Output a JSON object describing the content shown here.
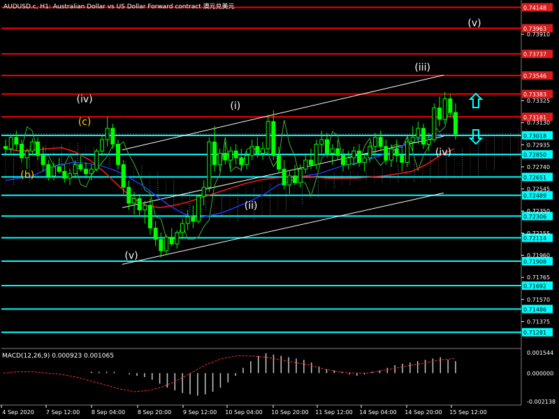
{
  "title_bar": "AUDUSD.c, H1:  Australian Dollar vs US Dollar Forward contract  澳元兑美元",
  "colors": {
    "background": "#000000",
    "candle": "#00ff00",
    "red_line": "#ff0000",
    "cyan_line": "#00ffff",
    "channel": "#ffffff",
    "ma_blue": "#1e3cff",
    "ma_red": "#ff1a1a",
    "oscillator": "#3cb43c",
    "label_box": "#d81e1e"
  },
  "chart_data": [
    {
      "type": "candlestick",
      "symbol": "AUDUSD.c",
      "timeframe": "H1",
      "ylim": [
        0.7115,
        0.742
      ],
      "xlabels": [
        "4 Sep 2020",
        "7 Sep 12:00",
        "8 Sep 04:00",
        "8 Sep 20:00",
        "9 Sep 12:00",
        "10 Sep 04:00",
        "10 Sep 20:00",
        "11 Sep 12:00",
        "14 Sep 04:00",
        "14 Sep 20:00",
        "15 Sep 12:00"
      ],
      "price_ticks": [
        "0.73910",
        "0.73325",
        "0.73130",
        "0.72935",
        "0.72740",
        "0.72545",
        "0.72350",
        "0.72155",
        "0.71960",
        "0.71765",
        "0.71570",
        "0.71375"
      ],
      "resistance_levels": [
        "0.74148",
        "0.73963",
        "0.73737",
        "0.73546",
        "0.73383",
        "0.73181"
      ],
      "support_levels": [
        "0.73018",
        "0.72850",
        "0.72651",
        "0.72489",
        "0.72306",
        "0.72114",
        "0.71908",
        "0.71692",
        "0.71486",
        "0.71281"
      ],
      "current_price": 0.7303,
      "wave_labels": [
        {
          "text": "(iv)",
          "color": "#ffffff",
          "x": 0.16,
          "price": 0.7331
        },
        {
          "text": "(c)",
          "color": "#ffd700",
          "x": 0.16,
          "price": 0.7311
        },
        {
          "text": "(b)",
          "color": "#ffd700",
          "x": 0.05,
          "price": 0.7264
        },
        {
          "text": "(v)",
          "color": "#ffffff",
          "x": 0.25,
          "price": 0.7193
        },
        {
          "text": "(i)",
          "color": "#ffffff",
          "x": 0.45,
          "price": 0.7325
        },
        {
          "text": "(ii)",
          "color": "#ffffff",
          "x": 0.48,
          "price": 0.7237
        },
        {
          "text": "(iii)",
          "color": "#ffffff",
          "x": 0.81,
          "price": 0.7359
        },
        {
          "text": "(iv)",
          "color": "#ffffff",
          "x": 0.85,
          "price": 0.7284
        },
        {
          "text": "(v)",
          "color": "#ffffff",
          "x": 0.91,
          "price": 0.7398
        }
      ],
      "candles": [
        [
          0.7292,
          0.7298,
          0.7284,
          0.729
        ],
        [
          0.729,
          0.7302,
          0.7286,
          0.73
        ],
        [
          0.73,
          0.7306,
          0.7288,
          0.7294
        ],
        [
          0.7294,
          0.7298,
          0.7278,
          0.7282
        ],
        [
          0.7282,
          0.729,
          0.7272,
          0.7288
        ],
        [
          0.7288,
          0.7299,
          0.7284,
          0.7296
        ],
        [
          0.7296,
          0.73,
          0.728,
          0.7284
        ],
        [
          0.7284,
          0.7292,
          0.727,
          0.7276
        ],
        [
          0.7276,
          0.728,
          0.7262,
          0.7266
        ],
        [
          0.7266,
          0.7278,
          0.7262,
          0.7274
        ],
        [
          0.7274,
          0.7282,
          0.7268,
          0.727
        ],
        [
          0.727,
          0.7276,
          0.726,
          0.7264
        ],
        [
          0.7264,
          0.7272,
          0.7258,
          0.7268
        ],
        [
          0.7268,
          0.728,
          0.7264,
          0.7276
        ],
        [
          0.7276,
          0.7284,
          0.727,
          0.7272
        ],
        [
          0.7272,
          0.7278,
          0.7264,
          0.7268
        ],
        [
          0.7268,
          0.7276,
          0.7262,
          0.7272
        ],
        [
          0.7272,
          0.729,
          0.727,
          0.7288
        ],
        [
          0.7288,
          0.7302,
          0.7284,
          0.7298
        ],
        [
          0.7298,
          0.7318,
          0.7292,
          0.7308
        ],
        [
          0.7308,
          0.7312,
          0.729,
          0.7294
        ],
        [
          0.7294,
          0.7298,
          0.7272,
          0.7276
        ],
        [
          0.7276,
          0.728,
          0.725,
          0.7256
        ],
        [
          0.7256,
          0.7262,
          0.7236,
          0.7242
        ],
        [
          0.7242,
          0.7252,
          0.7232,
          0.7246
        ],
        [
          0.7246,
          0.725,
          0.723,
          0.7236
        ],
        [
          0.7236,
          0.7244,
          0.7224,
          0.724
        ],
        [
          0.724,
          0.7246,
          0.7214,
          0.722
        ],
        [
          0.722,
          0.7226,
          0.7204,
          0.721
        ],
        [
          0.721,
          0.7216,
          0.7194,
          0.72
        ],
        [
          0.72,
          0.7214,
          0.7196,
          0.7212
        ],
        [
          0.7212,
          0.722,
          0.7204,
          0.7206
        ],
        [
          0.7206,
          0.7218,
          0.7202,
          0.7216
        ],
        [
          0.7216,
          0.7228,
          0.721,
          0.7224
        ],
        [
          0.7224,
          0.7236,
          0.7218,
          0.723
        ],
        [
          0.723,
          0.724,
          0.722,
          0.7226
        ],
        [
          0.7226,
          0.725,
          0.7224,
          0.7248
        ],
        [
          0.7248,
          0.7262,
          0.724,
          0.7256
        ],
        [
          0.7256,
          0.73,
          0.7252,
          0.7296
        ],
        [
          0.7296,
          0.731,
          0.727,
          0.7276
        ],
        [
          0.7276,
          0.729,
          0.727,
          0.7286
        ],
        [
          0.7286,
          0.7296,
          0.7276,
          0.728
        ],
        [
          0.728,
          0.7292,
          0.7272,
          0.7288
        ],
        [
          0.7288,
          0.7294,
          0.7276,
          0.7282
        ],
        [
          0.7282,
          0.729,
          0.727,
          0.7276
        ],
        [
          0.7276,
          0.7288,
          0.7272,
          0.7284
        ],
        [
          0.7284,
          0.7298,
          0.728,
          0.7292
        ],
        [
          0.7292,
          0.73,
          0.7282,
          0.7286
        ],
        [
          0.7286,
          0.7296,
          0.728,
          0.729
        ],
        [
          0.729,
          0.732,
          0.7286,
          0.7314
        ],
        [
          0.7314,
          0.7324,
          0.728,
          0.7284
        ],
        [
          0.7284,
          0.7292,
          0.7268,
          0.7272
        ],
        [
          0.7272,
          0.728,
          0.7254,
          0.7258
        ],
        [
          0.7258,
          0.727,
          0.725,
          0.7266
        ],
        [
          0.7266,
          0.7276,
          0.7258,
          0.726
        ],
        [
          0.726,
          0.7276,
          0.7256,
          0.7272
        ],
        [
          0.7272,
          0.7286,
          0.7268,
          0.728
        ],
        [
          0.728,
          0.729,
          0.7272,
          0.7276
        ],
        [
          0.7276,
          0.7298,
          0.7272,
          0.7294
        ],
        [
          0.7294,
          0.7306,
          0.7286,
          0.7298
        ],
        [
          0.7298,
          0.7304,
          0.7282,
          0.7286
        ],
        [
          0.7286,
          0.7294,
          0.7276,
          0.729
        ],
        [
          0.729,
          0.7298,
          0.728,
          0.7284
        ],
        [
          0.7284,
          0.729,
          0.727,
          0.7276
        ],
        [
          0.7276,
          0.7288,
          0.7272,
          0.7282
        ],
        [
          0.7282,
          0.7292,
          0.7276,
          0.7288
        ],
        [
          0.7288,
          0.7294,
          0.7274,
          0.7278
        ],
        [
          0.7278,
          0.7286,
          0.727,
          0.7282
        ],
        [
          0.7282,
          0.7296,
          0.7278,
          0.7292
        ],
        [
          0.7292,
          0.7304,
          0.7286,
          0.73
        ],
        [
          0.73,
          0.7306,
          0.7288,
          0.7292
        ],
        [
          0.7292,
          0.7298,
          0.7276,
          0.728
        ],
        [
          0.728,
          0.7294,
          0.7274,
          0.729
        ],
        [
          0.729,
          0.7298,
          0.7278,
          0.7284
        ],
        [
          0.7284,
          0.729,
          0.727,
          0.7278
        ],
        [
          0.7278,
          0.73,
          0.7274,
          0.7296
        ],
        [
          0.7296,
          0.731,
          0.7288,
          0.73
        ],
        [
          0.73,
          0.7314,
          0.7294,
          0.7308
        ],
        [
          0.7308,
          0.7312,
          0.729,
          0.7294
        ],
        [
          0.7294,
          0.7304,
          0.7288,
          0.7298
        ],
        [
          0.7298,
          0.733,
          0.7296,
          0.7326
        ],
        [
          0.7326,
          0.7336,
          0.731,
          0.7316
        ],
        [
          0.7316,
          0.734,
          0.7312,
          0.7334
        ],
        [
          0.7334,
          0.7338,
          0.7318,
          0.7322
        ],
        [
          0.7322,
          0.733,
          0.7298,
          0.7303
        ]
      ],
      "ma_blue": [
        0.7262,
        0.7264,
        0.7266,
        0.7272,
        0.7276,
        0.7278,
        0.7277,
        0.7275,
        0.7271,
        0.7265,
        0.7258,
        0.7249,
        0.724,
        0.7233,
        0.7229,
        0.7231,
        0.7234,
        0.7239,
        0.7244,
        0.725,
        0.7258,
        0.7262,
        0.7266,
        0.7268,
        0.7272,
        0.7276,
        0.7278,
        0.7282,
        0.7286,
        0.7292,
        0.7298,
        0.73,
        0.7303
      ],
      "ma_red": [
        0.729,
        0.7288,
        0.7289,
        0.729,
        0.7291,
        0.7287,
        0.728,
        0.727,
        0.7258,
        0.7247,
        0.724,
        0.7238,
        0.724,
        0.7243,
        0.7247,
        0.7251,
        0.7255,
        0.7259,
        0.7262,
        0.7264,
        0.7265,
        0.7266,
        0.7265,
        0.7264,
        0.7264,
        0.7264,
        0.7265,
        0.7266,
        0.7268,
        0.727,
        0.7276,
        0.7284,
        0.729
      ]
    },
    {
      "type": "bar",
      "indicator": "MACD(12,26,9)",
      "legend": "MACD(12,26,9) 0.000923 0.001065",
      "ylim": [
        -0.0023,
        0.0017
      ],
      "y_ticks": [
        "0.001544",
        "0.000000",
        "-0.002138"
      ],
      "values": [
        0.0,
        0.0001,
        0.0001,
        0.0001,
        0.0001,
        0.0,
        -0.0001,
        -0.0002,
        -0.0003,
        -0.0005,
        -0.0008,
        -0.0011,
        -0.0013,
        -0.0015,
        -0.0016,
        -0.0017,
        -0.0016,
        -0.0014,
        -0.0011,
        -0.0007,
        -0.0002,
        0.0004,
        0.0009,
        0.0013,
        0.0015,
        0.0014,
        0.0013,
        0.0012,
        0.0011,
        0.001,
        0.0008,
        0.0005,
        0.0003,
        0.0002,
        0.0001,
        -0.0001,
        -0.0002,
        -0.0001,
        0.0001,
        0.0002,
        0.0004,
        0.0006,
        0.0007,
        0.0008,
        0.0009,
        0.001,
        0.0011,
        0.0012,
        0.001,
        0.0009
      ],
      "signal": [
        0.0,
        0.0001,
        0.0001,
        0.0,
        -0.0001,
        -0.0003,
        -0.0006,
        -0.0009,
        -0.0012,
        -0.0014,
        -0.0013,
        -0.001,
        -0.0005,
        0.0001,
        0.0007,
        0.0011,
        0.0013,
        0.0013,
        0.0012,
        0.001,
        0.0008,
        0.0006,
        0.0003,
        0.0001,
        0.0,
        0.0,
        0.0002,
        0.0004,
        0.0006,
        0.0008,
        0.001,
        0.0011
      ]
    }
  ]
}
